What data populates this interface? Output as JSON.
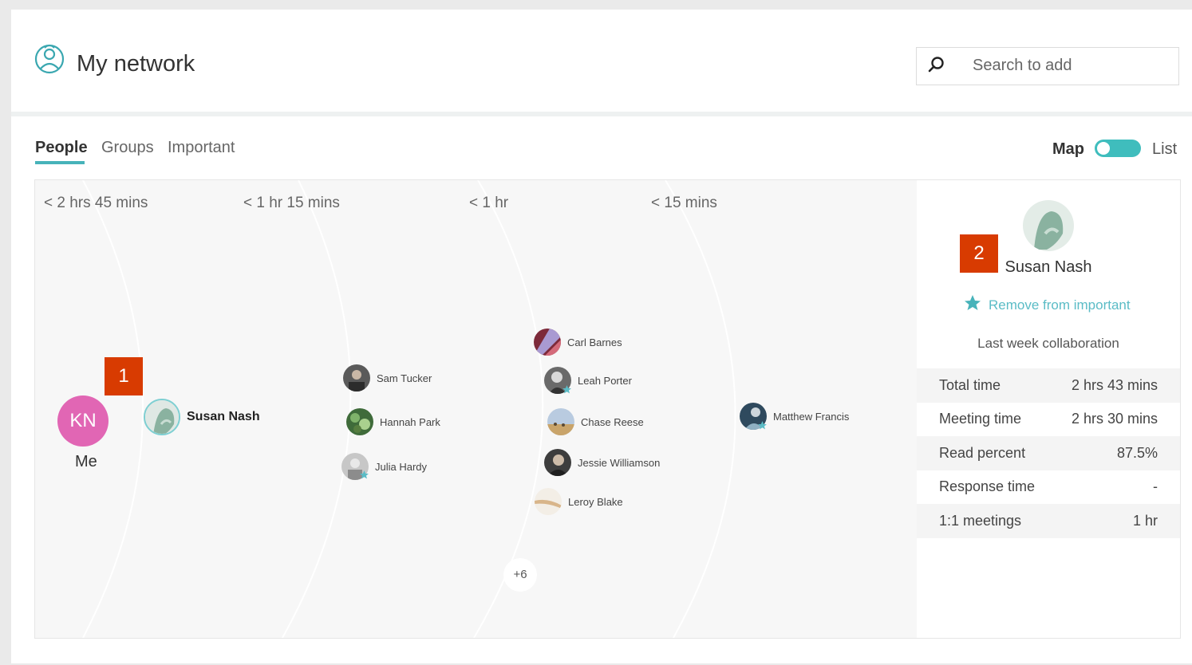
{
  "header": {
    "title": "My network",
    "icon": "network-person-icon"
  },
  "search": {
    "placeholder": "Search to add",
    "value": ""
  },
  "tabs": [
    {
      "label": "People",
      "active": true
    },
    {
      "label": "Groups",
      "active": false
    },
    {
      "label": "Important",
      "active": false
    }
  ],
  "view_toggle": {
    "map_label": "Map",
    "list_label": "List",
    "selected": "Map"
  },
  "map": {
    "bands": [
      "< 2 hrs 45 mins",
      "< 1 hr 15 mins",
      "< 1 hr",
      "< 15 mins"
    ],
    "me": {
      "initials": "KN",
      "label": "Me"
    },
    "focus_person": {
      "name": "Susan Nash"
    },
    "people": [
      {
        "name": "Sam Tucker",
        "important": false
      },
      {
        "name": "Hannah Park",
        "important": false
      },
      {
        "name": "Julia Hardy",
        "important": true
      },
      {
        "name": "Carl Barnes",
        "important": false
      },
      {
        "name": "Leah Porter",
        "important": true
      },
      {
        "name": "Chase Reese",
        "important": false
      },
      {
        "name": "Jessie Williamson",
        "important": false
      },
      {
        "name": "Leroy Blake",
        "important": false
      },
      {
        "name": "Matthew Francis",
        "important": true
      }
    ],
    "more_count": "+6"
  },
  "markers": [
    "1",
    "2"
  ],
  "detail_panel": {
    "name": "Susan Nash",
    "important_action": "Remove from important",
    "collab_title": "Last week collaboration",
    "stats": [
      {
        "label": "Total time",
        "value": "2 hrs 43 mins"
      },
      {
        "label": "Meeting time",
        "value": "2 hrs 30 mins"
      },
      {
        "label": "Read percent",
        "value": "87.5%"
      },
      {
        "label": "Response time",
        "value": "-"
      },
      {
        "label": "1:1 meetings",
        "value": "1 hr"
      }
    ]
  },
  "colors": {
    "accent": "#47b3ba",
    "toggle": "#3fbdbd",
    "me_avatar": "#e166b4",
    "marker": "#d83b01",
    "star": "#5bbcc6"
  }
}
